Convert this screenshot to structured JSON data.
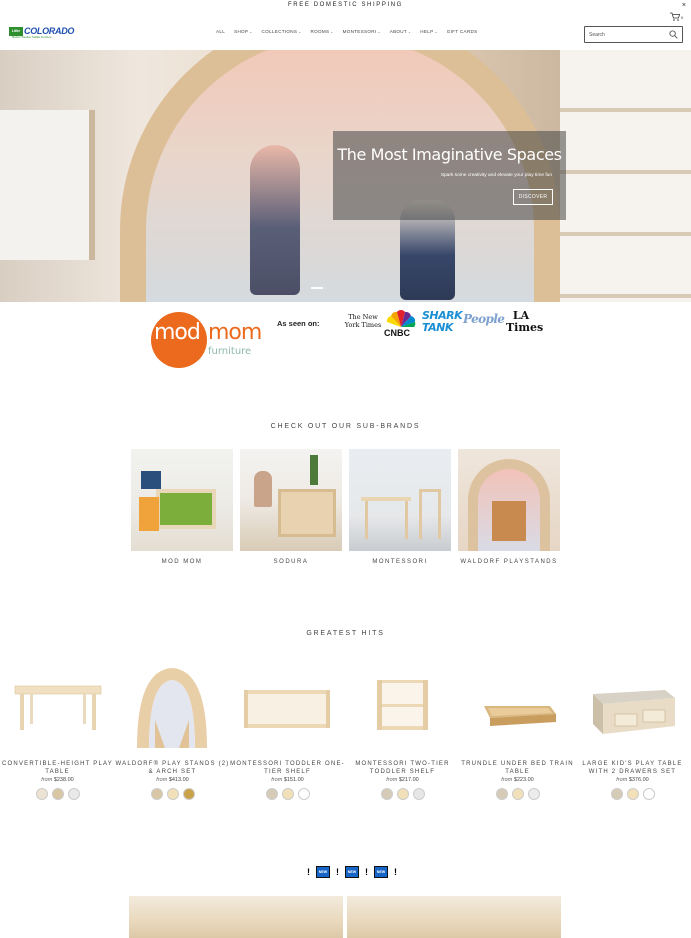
{
  "announcement": {
    "text": "FREE DOMESTIC SHIPPING",
    "close": "×"
  },
  "header": {
    "logo": {
      "box": "Little",
      "word": "COLORADO",
      "tagline": "Modern Wooden Toddler Furniture"
    },
    "nav": [
      {
        "label": "ALL",
        "has_menu": false
      },
      {
        "label": "SHOP",
        "has_menu": true
      },
      {
        "label": "COLLECTIONS",
        "has_menu": true
      },
      {
        "label": "ROOMS",
        "has_menu": true
      },
      {
        "label": "MONTESSORI",
        "has_menu": true
      },
      {
        "label": "ABOUT",
        "has_menu": true
      },
      {
        "label": "HELP",
        "has_menu": true
      },
      {
        "label": "GIFT CARDS",
        "has_menu": false
      }
    ],
    "cart_count": "0",
    "search_placeholder": "Search"
  },
  "hero": {
    "title": "The Most Imaginative Spaces",
    "subtitle": "Spark some creativity and elevate your play time fun",
    "button": "DISCOVER"
  },
  "press": {
    "modmom": {
      "mod": "mod",
      "mom": "mom",
      "furniture": "furniture"
    },
    "seen_on": "As seen on:",
    "logos": {
      "nyt": "The New York Times",
      "cnbc": "CNBC",
      "shark": "SHARK TANK",
      "people": "People",
      "latimes": "LA Times"
    }
  },
  "sub_brands": {
    "title": "CHECK OUT OUR SUB-BRANDS",
    "items": [
      {
        "label": "MOD MOM"
      },
      {
        "label": "SODURA"
      },
      {
        "label": "MONTESSORI"
      },
      {
        "label": "WALDORF PLAYSTANDS"
      }
    ]
  },
  "greatest_hits": {
    "title": "GREATEST HITS",
    "products": [
      {
        "name": "CONVERTIBLE-HEIGHT PLAY TABLE",
        "from": "from",
        "price": "$238.00",
        "swatches": [
          "#ece3d3",
          "#d8c6a4",
          "#e9e9e9"
        ]
      },
      {
        "name": "WALDORF® PLAY STANDS (2) & ARCH SET",
        "from": "from",
        "price": "$413.00",
        "swatches": [
          "#d8c6a4",
          "#f2e0b8",
          "#c9a24a"
        ]
      },
      {
        "name": "MONTESSORI TODDLER ONE-TIER SHELF",
        "from": "from",
        "price": "$151.00",
        "swatches": [
          "#d6cbb7",
          "#f2e0b8",
          "#ffffff"
        ]
      },
      {
        "name": "MONTESSORI TWO-TIER TODDLER SHELF",
        "from": "from",
        "price": "$217.00",
        "swatches": [
          "#d6cbb7",
          "#f2e0b8",
          "#e6e6e6"
        ]
      },
      {
        "name": "TRUNDLE UNDER BED TRAIN TABLE",
        "from": "from",
        "price": "$223.00",
        "swatches": [
          "#d6cbb7",
          "#f2e0b8",
          "#ececec"
        ]
      },
      {
        "name": "LARGE KID'S PLAY TABLE WITH 2 DRAWERS SET",
        "from": "from",
        "price": "$376.00",
        "swatches": [
          "#d6cbb7",
          "#f2e0b8",
          "#ffffff"
        ]
      }
    ]
  },
  "new_badges": {
    "mark": "!",
    "badge": "NEW"
  }
}
